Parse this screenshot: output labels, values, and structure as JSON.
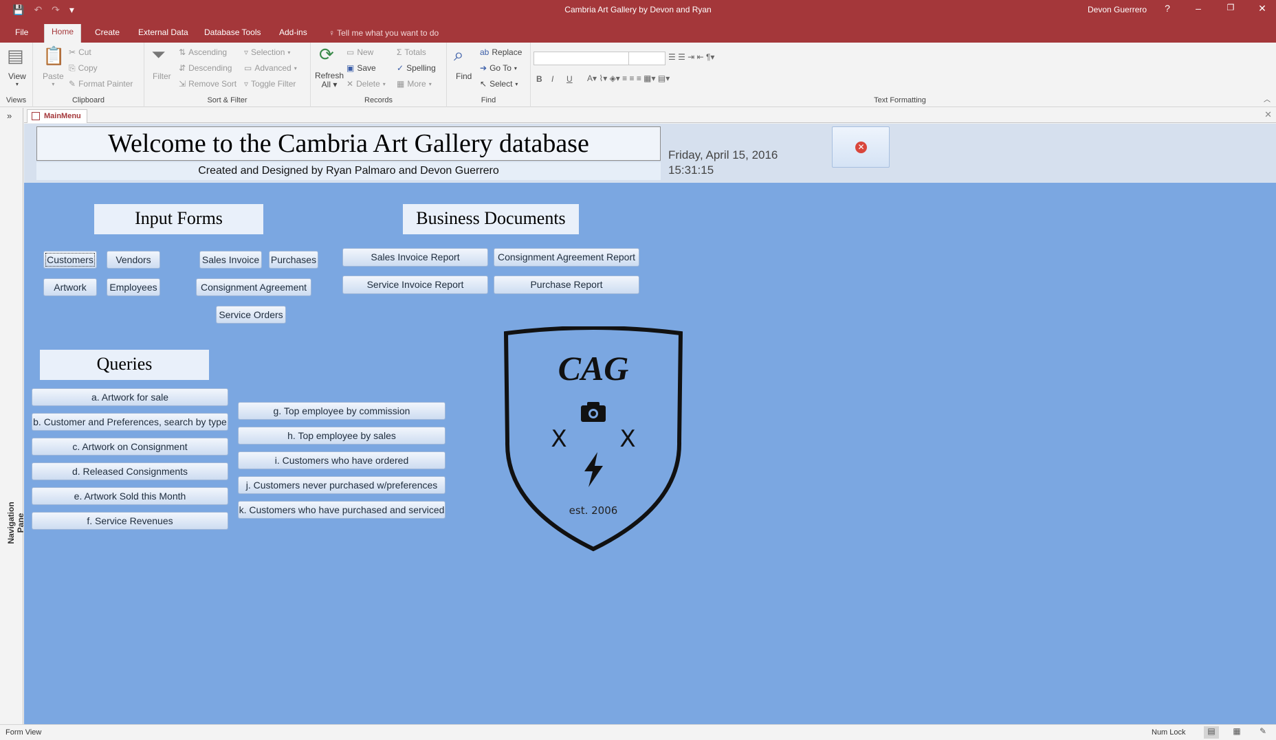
{
  "window": {
    "title": "Cambria Art Gallery by Devon and Ryan",
    "user": "Devon Guerrero",
    "help": "?",
    "minimize": "–",
    "restore": "❐",
    "close": "✕"
  },
  "qat": {
    "save": "💾",
    "undo": "↶",
    "redo": "↷",
    "customize": "▾"
  },
  "ribbon_tabs": [
    {
      "label": "File"
    },
    {
      "label": "Home"
    },
    {
      "label": "Create"
    },
    {
      "label": "External Data"
    },
    {
      "label": "Database Tools"
    },
    {
      "label": "Add-ins"
    }
  ],
  "tell_me": "Tell me what you want to do",
  "ribbon": {
    "views": {
      "view": "View",
      "label": "Views"
    },
    "clipboard": {
      "paste": "Paste",
      "cut": "Cut",
      "copy": "Copy",
      "format_painter": "Format Painter",
      "label": "Clipboard"
    },
    "sort_filter": {
      "filter": "Filter",
      "ascending": "Ascending",
      "descending": "Descending",
      "remove_sort": "Remove Sort",
      "selection": "Selection",
      "advanced": "Advanced",
      "toggle_filter": "Toggle Filter",
      "label": "Sort & Filter"
    },
    "records": {
      "refresh": "Refresh",
      "refresh2": "All",
      "new": "New",
      "save": "Save",
      "delete": "Delete",
      "totals": "Totals",
      "spelling": "Spelling",
      "more": "More",
      "label": "Records"
    },
    "find": {
      "find": "Find",
      "replace": "Replace",
      "goto": "Go To",
      "select": "Select",
      "label": "Find"
    },
    "text_formatting": {
      "bold": "B",
      "italic": "I",
      "underline": "U",
      "label": "Text Formatting"
    }
  },
  "nav_pane": {
    "label": "Navigation Pane",
    "toggle": "»"
  },
  "doc_tab": {
    "label": "MainMenu"
  },
  "form": {
    "title": "Welcome to the Cambria Art Gallery database",
    "subtitle": "Created and Designed by Ryan Palmaro and Devon Guerrero",
    "date": "Friday, April 15, 2016",
    "time": "15:31:15",
    "close_icon": "✕"
  },
  "input_forms": {
    "heading": "Input Forms",
    "buttons": [
      "Customers",
      "Vendors",
      "Artwork",
      "Employees",
      "Sales Invoice",
      "Purchases",
      "Consignment Agreement",
      "Service Orders"
    ]
  },
  "business_documents": {
    "heading": "Business Documents",
    "buttons": [
      "Sales Invoice Report",
      "Consignment Agreement Report",
      "Service Invoice Report",
      "Purchase Report"
    ]
  },
  "queries": {
    "heading": "Queries",
    "left": [
      "a. Artwork for sale",
      "b. Customer and Preferences, search by type",
      "c. Artwork on Consignment",
      "d. Released Consignments",
      "e. Artwork Sold this Month",
      "f. Service Revenues"
    ],
    "right": [
      "g. Top employee by commission",
      "h. Top employee by sales",
      "i. Customers who have ordered",
      "j. Customers never purchased w/preferences",
      "k. Customers who have purchased and serviced"
    ]
  },
  "logo": {
    "initials": "CAG",
    "mark_left": "X",
    "mark_right": "X",
    "est": "est. 2006"
  },
  "status": {
    "view": "Form View",
    "num_lock": "Num Lock"
  },
  "colors": {
    "accent": "#a4373a",
    "form_bg": "#7ba7e1",
    "header_bg": "#d6e0ee"
  }
}
